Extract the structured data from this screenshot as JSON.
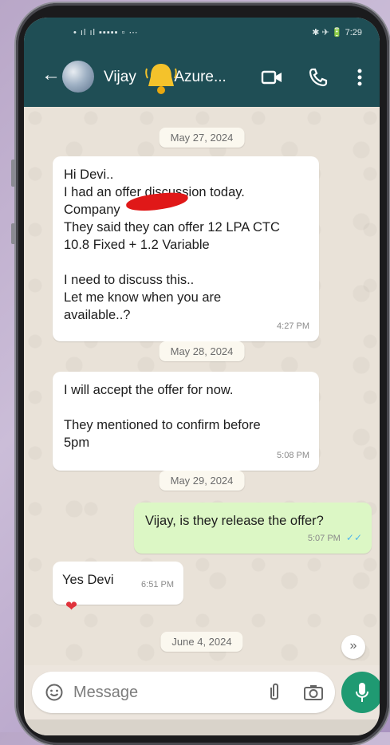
{
  "status_bar": {
    "left_text": "• ıl ıl ▪▪▪▪▪ ▫ ⋯",
    "right_text": "✱ ✈ 🔋 7:29"
  },
  "header": {
    "contact_name": "Vijay",
    "contact_suffix": "Azure...",
    "icons": [
      "back-arrow-icon",
      "video-call-icon",
      "voice-call-icon",
      "more-options-icon"
    ]
  },
  "chat": {
    "dates": [
      "May 27, 2024",
      "May 28, 2024",
      "May 29, 2024",
      "June 4, 2024"
    ],
    "messages": [
      {
        "direction": "incoming",
        "lines": [
          "Hi Devi..",
          "I had an offer discussion today.",
          "Company",
          "They said they can offer 12 LPA CTC",
          "10.8 Fixed + 1.2 Variable",
          "",
          "I need to discuss this..",
          "Let me know when you are",
          "available..?"
        ],
        "time": "4:27 PM"
      },
      {
        "direction": "incoming",
        "lines": [
          "I will accept the offer for now.",
          "",
          "They mentioned to confirm before",
          "5pm"
        ],
        "time": "5:08 PM"
      },
      {
        "direction": "outgoing",
        "lines": [
          "Vijay, is they release the offer?"
        ],
        "time": "5:07 PM",
        "read_ticks": "✓✓"
      },
      {
        "direction": "incoming",
        "lines": [
          "Yes Devi"
        ],
        "time": "6:51 PM",
        "reaction": "❤"
      }
    ]
  },
  "input": {
    "placeholder": "Message"
  },
  "colors": {
    "header": "#1f4e55",
    "outgoing_bubble": "#dcf7c5",
    "mic_button": "#1f9a72",
    "redaction": "#e01818"
  }
}
